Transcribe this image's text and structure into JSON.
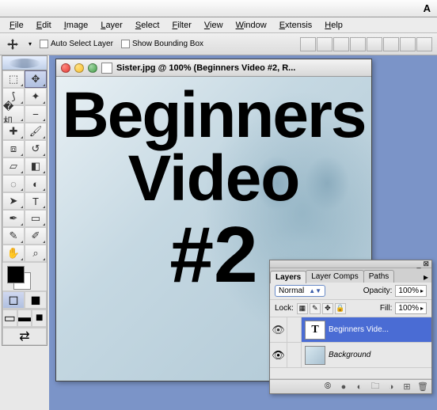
{
  "mac_menu": {
    "apple": "",
    "app_initial": "A"
  },
  "app_menu": [
    "File",
    "Edit",
    "Image",
    "Layer",
    "Select",
    "Filter",
    "View",
    "Window",
    "Extensis",
    "Help"
  ],
  "options": {
    "auto_select": "Auto Select Layer",
    "show_bbox": "Show Bounding Box"
  },
  "document": {
    "title": "Sister.jpg @ 100% (Beginners Video #2, R...",
    "overlay_line1": "Beginners",
    "overlay_line2": "Video",
    "overlay_line3": "#2"
  },
  "layers_panel": {
    "tabs": [
      "Layers",
      "Layer Comps",
      "Paths"
    ],
    "blend_mode": "Normal",
    "opacity_label": "Opacity:",
    "opacity_value": "100%",
    "lock_label": "Lock:",
    "fill_label": "Fill:",
    "fill_value": "100%",
    "layers": [
      {
        "name": "Beginners Vide...",
        "type": "text",
        "thumb": "T",
        "visible": true,
        "selected": true
      },
      {
        "name": "Background",
        "type": "bg",
        "thumb": "",
        "visible": true,
        "selected": false
      }
    ]
  },
  "tools": [
    [
      "marquee-rect",
      "move"
    ],
    [
      "lasso",
      "magic-wand"
    ],
    [
      "crop",
      "slice"
    ],
    [
      "healing",
      "brush"
    ],
    [
      "stamp",
      "history-brush"
    ],
    [
      "eraser",
      "gradient"
    ],
    [
      "blur",
      "dodge"
    ],
    [
      "path-select",
      "type"
    ],
    [
      "pen",
      "shape"
    ],
    [
      "notes",
      "eyedropper"
    ],
    [
      "hand",
      "zoom"
    ]
  ],
  "tool_glyphs": {
    "marquee-rect": "⬚",
    "move": "✥",
    "lasso": "⟆",
    "magic-wand": "✦",
    "crop": "�机",
    "slice": "⎯",
    "healing": "✚",
    "brush": "🖌",
    "stamp": "⧈",
    "history-brush": "↺",
    "eraser": "▱",
    "gradient": "◧",
    "blur": "◌",
    "dodge": "◐",
    "path-select": "➤",
    "type": "T",
    "pen": "✒",
    "shape": "▭",
    "notes": "✎",
    "eyedropper": "✐",
    "hand": "✋",
    "zoom": "⌕"
  },
  "selected_tool": "move"
}
